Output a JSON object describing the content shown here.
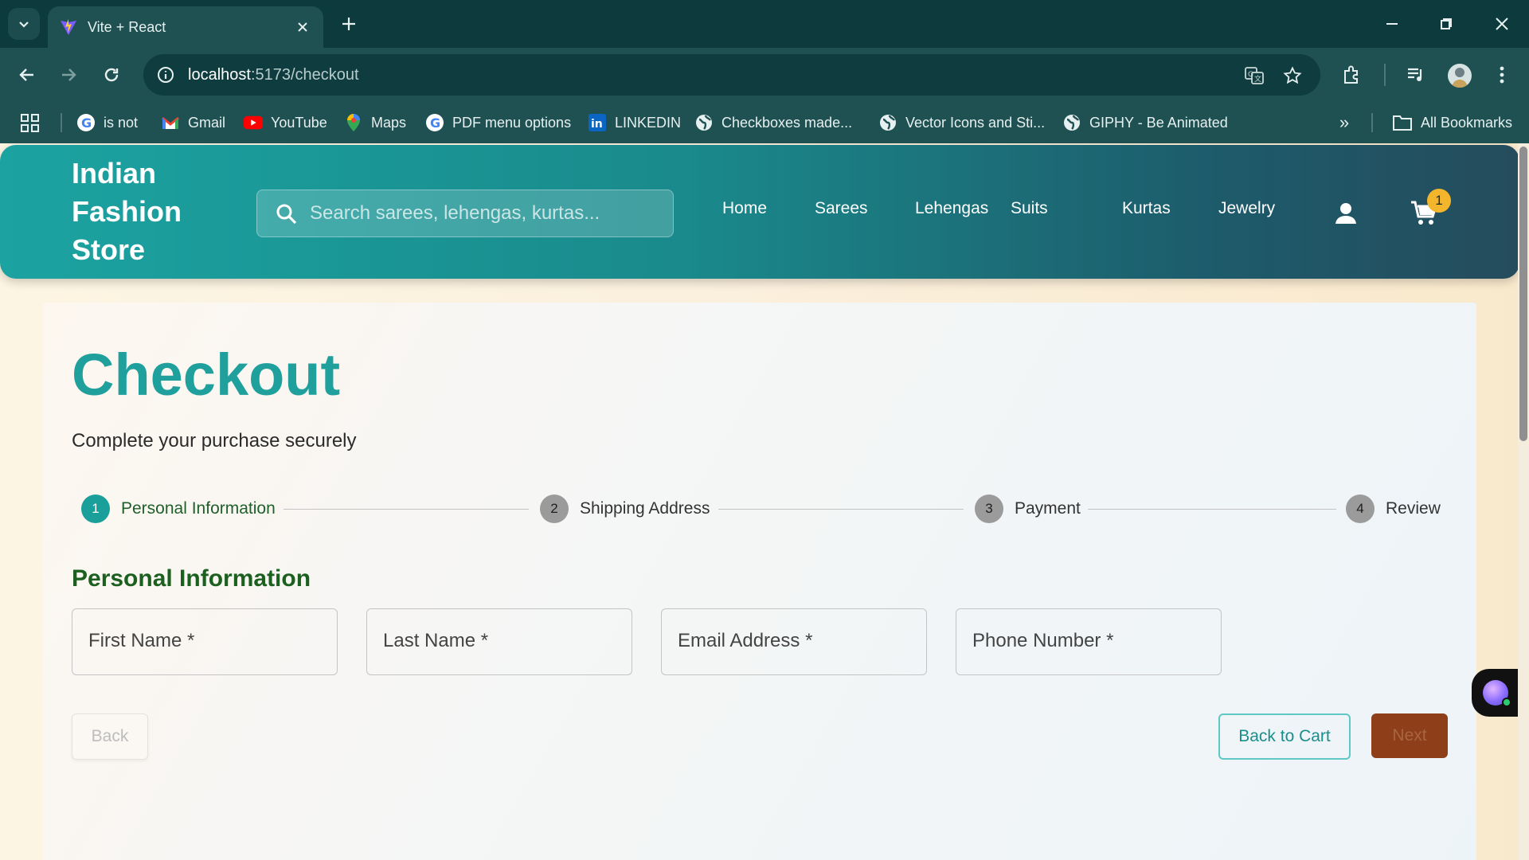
{
  "browser": {
    "tab_title": "Vite + React",
    "url_host": "localhost",
    "url_path": ":5173/checkout",
    "bookmarks": [
      {
        "label": "is not",
        "icon": "google-icon"
      },
      {
        "label": "Gmail",
        "icon": "gmail-icon"
      },
      {
        "label": "YouTube",
        "icon": "youtube-icon"
      },
      {
        "label": "Maps",
        "icon": "maps-icon"
      },
      {
        "label": "PDF menu options",
        "icon": "google-icon"
      },
      {
        "label": "LINKEDIN",
        "icon": "linkedin-icon"
      },
      {
        "label": "Checkboxes made...",
        "icon": "globe-icon"
      },
      {
        "label": "Vector Icons and Sti...",
        "icon": "globe-icon"
      },
      {
        "label": "GIPHY - Be Animated",
        "icon": "globe-icon"
      }
    ],
    "all_bookmarks": "All Bookmarks"
  },
  "header": {
    "logo": "Indian Fashion Store",
    "search_placeholder": "Search sarees, lehengas, kurtas...",
    "nav": [
      "Home",
      "Sarees",
      "Lehengas",
      "Suits",
      "Kurtas",
      "Jewelry"
    ],
    "cart_count": "1",
    "accent": "#1ba3a1"
  },
  "checkout": {
    "title": "Checkout",
    "subtitle": "Complete your purchase securely",
    "steps": [
      {
        "num": "1",
        "label": "Personal Information",
        "active": true
      },
      {
        "num": "2",
        "label": "Shipping Address",
        "active": false
      },
      {
        "num": "3",
        "label": "Payment",
        "active": false
      },
      {
        "num": "4",
        "label": "Review",
        "active": false
      }
    ],
    "section_title": "Personal Information",
    "fields": [
      "First Name *",
      "Last Name *",
      "Email Address *",
      "Phone Number *"
    ],
    "buttons": {
      "back": "Back",
      "back_to_cart": "Back to Cart",
      "next": "Next"
    }
  }
}
